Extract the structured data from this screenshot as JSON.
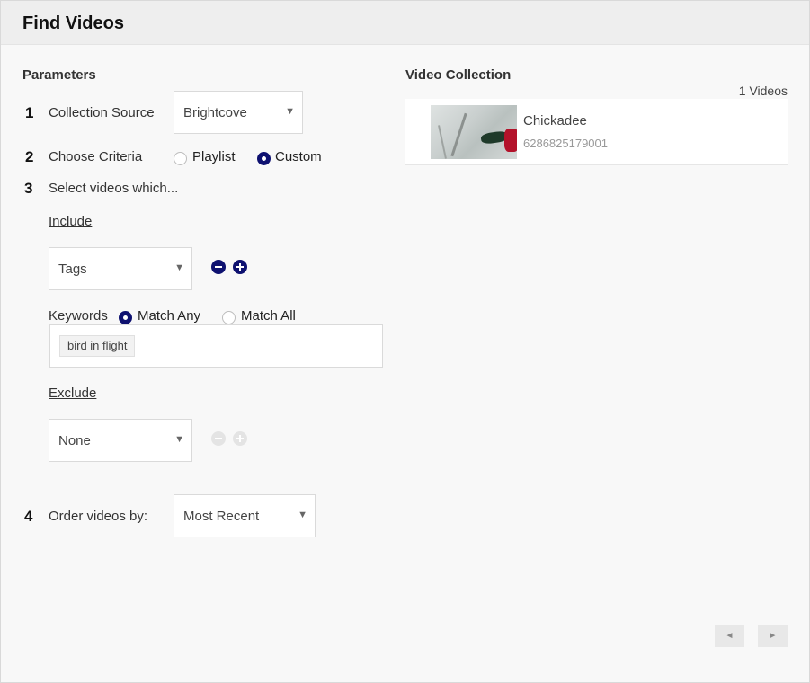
{
  "header": {
    "title": "Find Videos"
  },
  "params": {
    "title": "Parameters",
    "step1": {
      "num": "1",
      "label": "Collection Source",
      "value": "Brightcove"
    },
    "step2": {
      "num": "2",
      "label": "Choose Criteria",
      "options": [
        "Playlist",
        "Custom"
      ],
      "selected": "Custom"
    },
    "step3": {
      "num": "3",
      "label": "Select videos which..."
    },
    "include": {
      "title": "Include",
      "field_value": "Tags",
      "keywords_label": "Keywords",
      "match_options": [
        "Match Any",
        "Match All"
      ],
      "match_selected": "Match Any",
      "tags": [
        "bird in flight"
      ]
    },
    "exclude": {
      "title": "Exclude",
      "field_value": "None"
    },
    "step4": {
      "num": "4",
      "label": "Order videos by:",
      "value": "Most Recent"
    }
  },
  "collection": {
    "title": "Video Collection",
    "count": "1 Videos",
    "videos": [
      {
        "title": "Chickadee",
        "id": "6286825179001"
      }
    ]
  },
  "icons": {
    "caret": "▼",
    "prev": "◄",
    "next": "►"
  },
  "colors": {
    "accent": "#0e1170",
    "header_bg": "#eeeeee",
    "page_bg": "#f8f8f8"
  }
}
